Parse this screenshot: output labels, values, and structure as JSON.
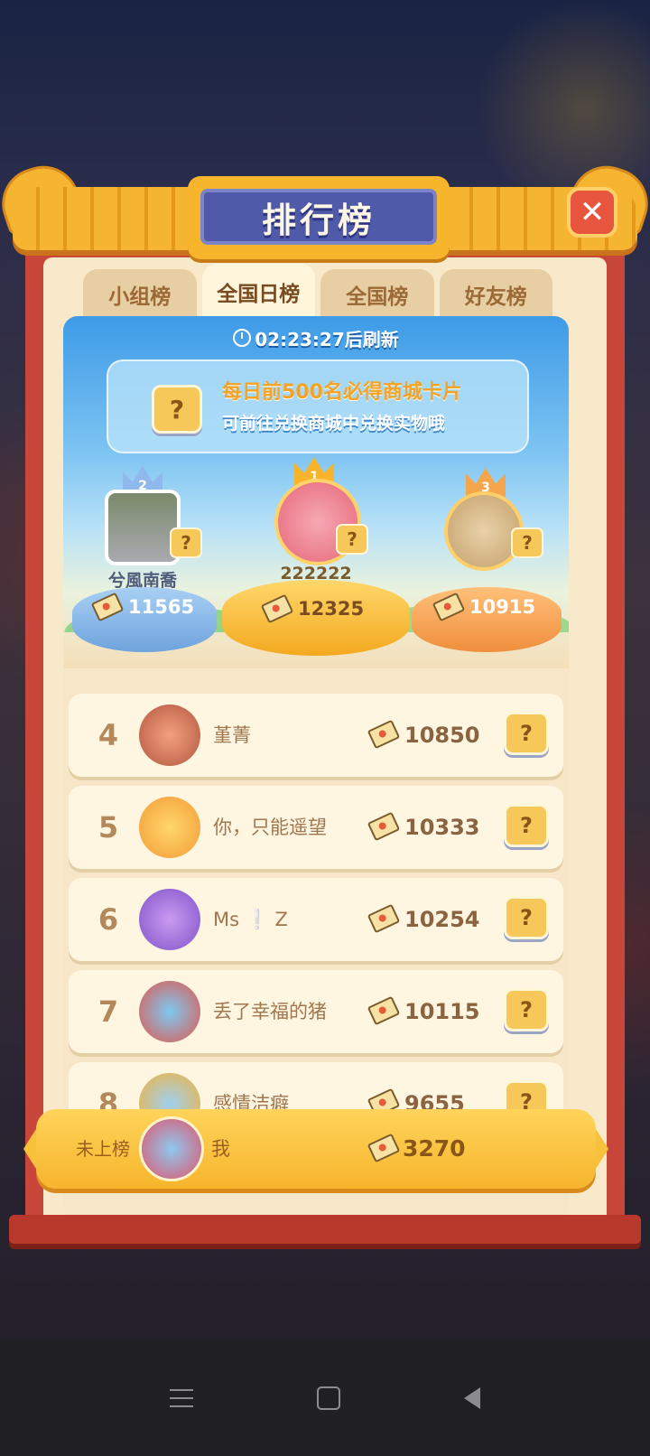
{
  "title": "排行榜",
  "tabs": [
    {
      "label": "小组榜",
      "active": false
    },
    {
      "label": "全国日榜",
      "active": true
    },
    {
      "label": "全国榜",
      "active": false
    },
    {
      "label": "好友榜",
      "active": false
    }
  ],
  "timer_text": "02:23:27后刷新",
  "banner": {
    "line1": "每日前500名必得商城卡片",
    "line2": "可前往兑换商城中兑换实物哦"
  },
  "card_icon_glyph": "?",
  "podium": [
    {
      "rank": "2",
      "name": "兮風南喬",
      "score": "11565",
      "color": "#7fb2e6"
    },
    {
      "rank": "1",
      "name": "222222",
      "score": "12325",
      "color": "#f6b52d"
    },
    {
      "rank": "3",
      "name": "",
      "score": "10915",
      "color": "#f39a4a"
    }
  ],
  "rows": [
    {
      "rank": "4",
      "name": "堇菁",
      "score": "10850"
    },
    {
      "rank": "5",
      "name": "你，只能遥望",
      "score": "10333"
    },
    {
      "rank": "6",
      "name": "Ms ❕ Z",
      "score": "10254"
    },
    {
      "rank": "7",
      "name": "丢了幸福的猪",
      "score": "10115"
    },
    {
      "rank": "8",
      "name": "感情洁癖",
      "score": "9655"
    }
  ],
  "me": {
    "status": "未上榜",
    "name": "我",
    "score": "3270"
  },
  "icons": {
    "close": "close-icon",
    "clock": "clock-icon",
    "ticket": "ticket-icon",
    "card": "mystery-card-icon"
  },
  "colors": {
    "accent": "#f6b52d",
    "frame": "#c9473a",
    "title_plaque": "#4f5aa8"
  }
}
